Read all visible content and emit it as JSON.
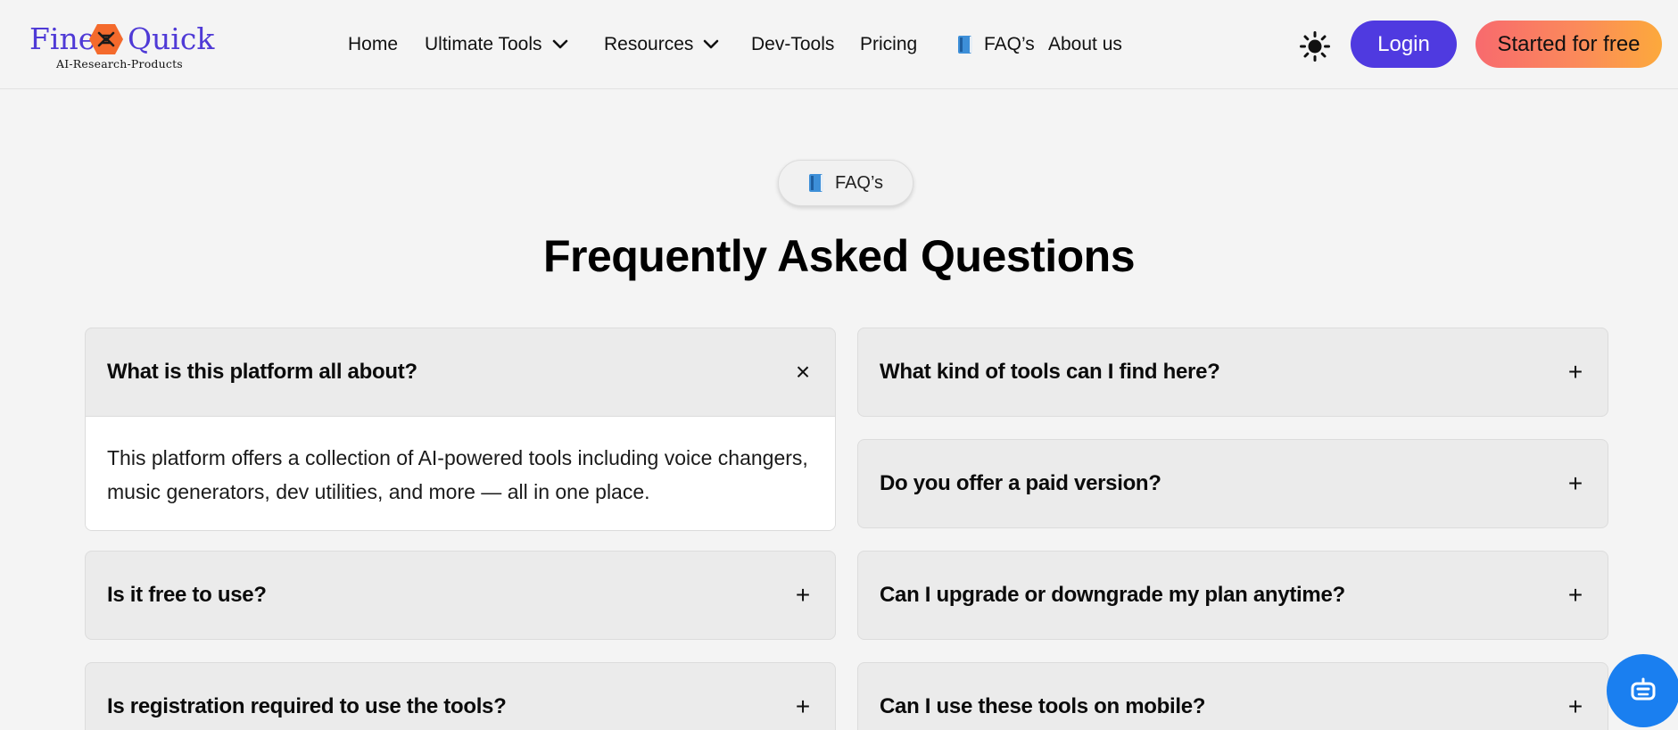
{
  "brand": {
    "word1": "Fine",
    "word2": "Quick",
    "tagline": "AI-Research-Products",
    "color": "#4f3ad6",
    "mark_color": "#f46a2c"
  },
  "nav": {
    "home": "Home",
    "ultimate_tools": "Ultimate Tools",
    "resources": "Resources",
    "dev_tools": "Dev-Tools",
    "pricing": "Pricing",
    "faqs": "FAQ’s",
    "about": "About us"
  },
  "header_actions": {
    "theme_icon": "sun-icon",
    "login": "Login",
    "start": "Started for free",
    "login_color": "#4f3ae0"
  },
  "faq_section": {
    "pill": "FAQ’s",
    "title": "Frequently Asked Questions"
  },
  "faqs": {
    "left": [
      {
        "question": "What is this platform all about?",
        "toggle": "×",
        "expanded": true,
        "answer": "This platform offers a collection of AI-powered tools including voice changers, music generators, dev utilities, and more — all in one place."
      },
      {
        "question": "Is it free to use?",
        "toggle": "+",
        "expanded": false
      },
      {
        "question": "Is registration required to use the tools?",
        "toggle": "+",
        "expanded": false
      }
    ],
    "right": [
      {
        "question": "What kind of tools can I find here?",
        "toggle": "+",
        "expanded": false
      },
      {
        "question": "Do you offer a paid version?",
        "toggle": "+",
        "expanded": false
      },
      {
        "question": "Can I upgrade or downgrade my plan anytime?",
        "toggle": "+",
        "expanded": false
      },
      {
        "question": "Can I use these tools on mobile?",
        "toggle": "+",
        "expanded": false
      }
    ]
  },
  "chat_widget": {
    "icon": "robot-chat-icon",
    "color": "#1a7ff0"
  }
}
